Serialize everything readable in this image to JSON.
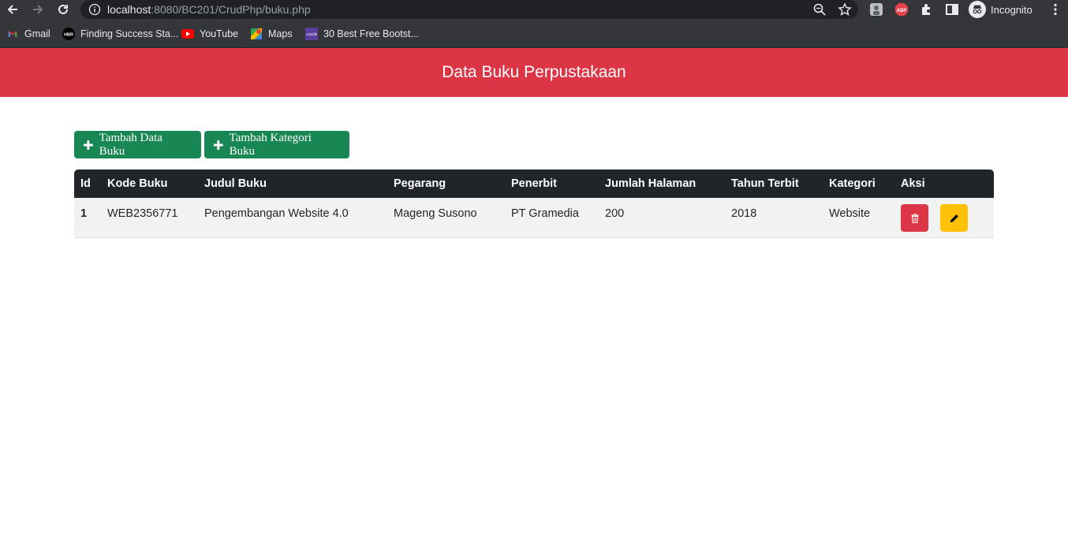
{
  "browser": {
    "url_host": "localhost",
    "url_path": ":8080/BC201/CrudPhp/buku.php",
    "profile_label": "Incognito",
    "bookmarks": [
      {
        "label": "Gmail",
        "icon": "gmail-icon"
      },
      {
        "label": "Finding Success Sta...",
        "icon": "hbr-icon"
      },
      {
        "label": "YouTube",
        "icon": "youtube-icon"
      },
      {
        "label": "Maps",
        "icon": "maps-icon"
      },
      {
        "label": "30 Best Free Bootst...",
        "icon": "colorlib-icon"
      }
    ]
  },
  "header": {
    "title": "Data Buku Perpustakaan",
    "color": "#dc3545"
  },
  "actions": {
    "add_book": "Tambah Data Buku",
    "add_category": "Tambah Kategori Buku",
    "color": "#198754"
  },
  "table": {
    "columns": [
      "Id",
      "Kode Buku",
      "Judul Buku",
      "Pegarang",
      "Penerbit",
      "Jumlah Halaman",
      "Tahun Terbit",
      "Kategori",
      "Aksi"
    ],
    "rows": [
      {
        "id": "1",
        "kode": "WEB2356771",
        "judul": "Pengembangan Website 4.0",
        "pengarang": "Mageng Susono",
        "penerbit": "PT Gramedia",
        "halaman": "200",
        "tahun": "2018",
        "kategori": "Website"
      }
    ],
    "row_actions": [
      "trash-icon",
      "pencil-icon"
    ]
  }
}
